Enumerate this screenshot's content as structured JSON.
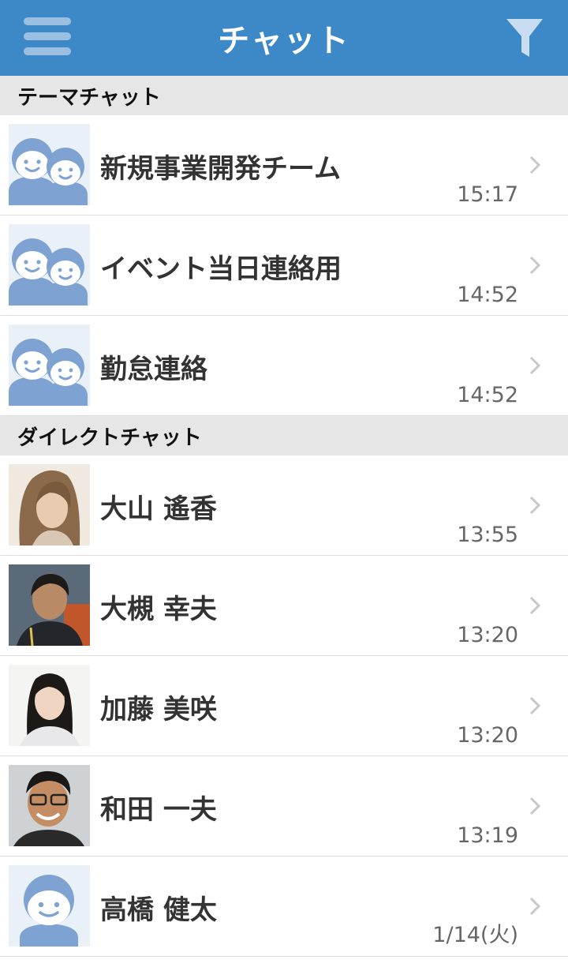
{
  "header": {
    "title": "チャット"
  },
  "theme_section": {
    "label": "テーマチャット",
    "items": [
      {
        "name": "新規事業開発チーム",
        "time": "15:17",
        "avatar": "group-avatar-icon"
      },
      {
        "name": "イベント当日連絡用",
        "time": "14:52",
        "avatar": "group-avatar-icon"
      },
      {
        "name": "勤怠連絡",
        "time": "14:52",
        "avatar": "group-avatar-icon"
      }
    ]
  },
  "direct_section": {
    "label": "ダイレクトチャット",
    "items": [
      {
        "name": "大山 遙香",
        "time": "13:55",
        "avatar": "user-photo"
      },
      {
        "name": "大槻 幸夫",
        "time": "13:20",
        "avatar": "user-photo"
      },
      {
        "name": "加藤 美咲",
        "time": "13:20",
        "avatar": "user-photo"
      },
      {
        "name": "和田 一夫",
        "time": "13:19",
        "avatar": "user-photo"
      },
      {
        "name": "高橋 健太",
        "time": "1/14(火)",
        "avatar": "default-user-avatar-icon"
      }
    ]
  },
  "colors": {
    "header_bg": "#3d89c8",
    "avatar_blue": "#7ea3d3",
    "section_bg": "#e6e6e6"
  }
}
